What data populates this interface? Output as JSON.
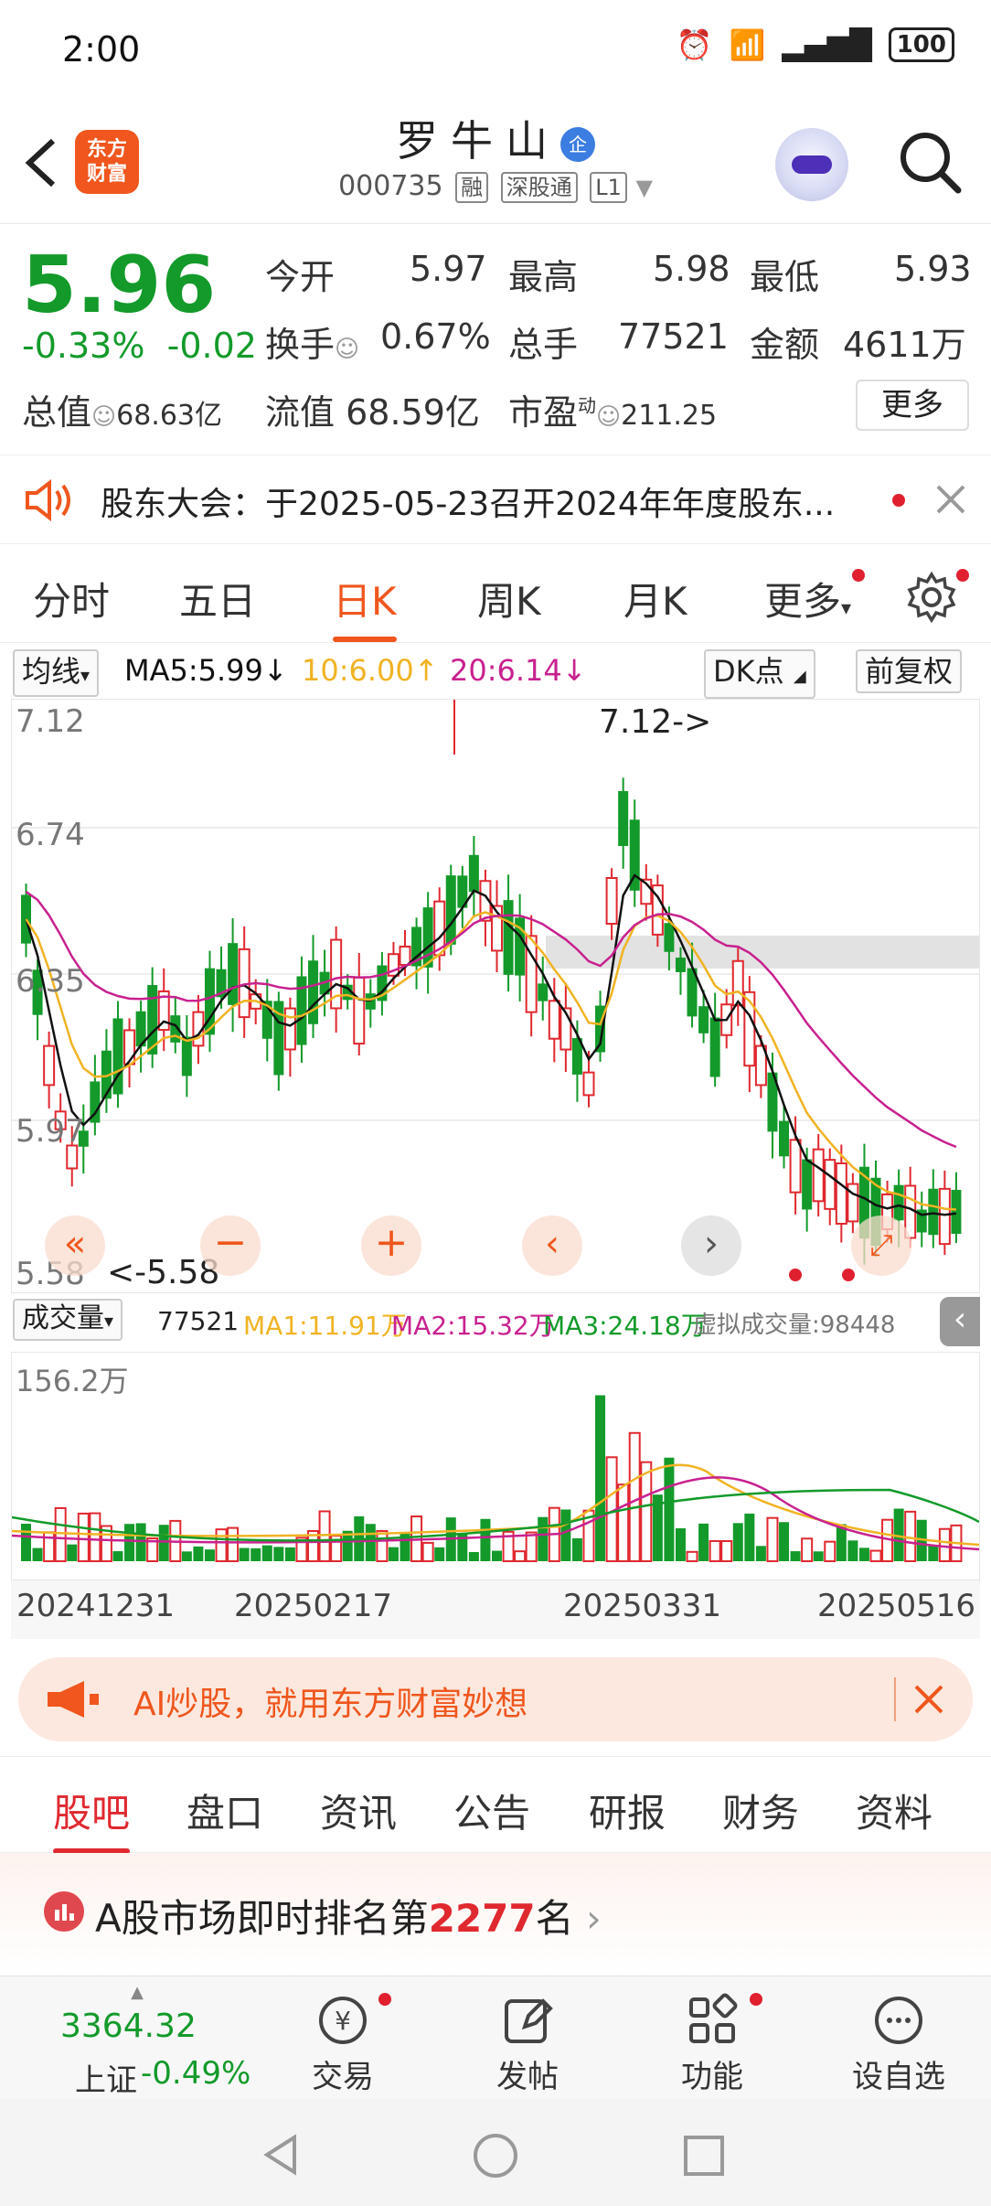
{
  "status_bar": {
    "time": "2:00",
    "battery": "100"
  },
  "header": {
    "logo_text_1": "东方",
    "logo_text_2": "财富",
    "title": "罗牛山",
    "enterprise_badge": "企",
    "code": "000735",
    "tags": [
      "融",
      "深股通",
      "L1"
    ]
  },
  "quote": {
    "price": "5.96",
    "change_pct": "-0.33%",
    "change": "-0.02",
    "open_label": "今开",
    "open": "5.97",
    "high_label": "最高",
    "high": "5.98",
    "low_label": "最低",
    "low": "5.93",
    "turnover_label": "换手",
    "turnover": "0.67%",
    "volume_label": "总手",
    "volume": "77521",
    "amount_label": "金额",
    "amount": "4611万",
    "mktcap_label": "总值",
    "mktcap": "68.63亿",
    "float_label": "流值",
    "float_cap": "68.59亿",
    "pe_label": "市盈",
    "pe_sup": "动",
    "pe": "211.25",
    "more": "更多"
  },
  "notice": {
    "text": "股东大会：于2025-05-23召开2024年年度股东..."
  },
  "chart_tabs": [
    "分时",
    "五日",
    "日K",
    "周K",
    "月K",
    "更多"
  ],
  "ma_bar": {
    "selector": "均线",
    "ma5": "MA5:5.99",
    "ma10": "10:6.00",
    "ma20": "20:6.14",
    "dk": "DK点",
    "fq": "前复权"
  },
  "colors": {
    "up": "#e0282f",
    "down": "#139a2a",
    "accent": "#f0561d",
    "ma5": "#111111",
    "ma10": "#f0b323",
    "ma20": "#c8218f"
  },
  "kchart_labels": {
    "p1": "7.12",
    "p2": "6.74",
    "p3": "6.35",
    "p4": "5.97",
    "p5": "5.58",
    "max_note": "7.12->",
    "min_note": "<-5.58"
  },
  "vol_bar": {
    "selector": "成交量",
    "vol": "77521",
    "ma1": "MA1:11.91万",
    "ma2": "MA2:15.32万",
    "ma3": "MA3:24.18万",
    "virtual": "虚拟成交量:98448",
    "max": "156.2万"
  },
  "dates": [
    "20241231",
    "20250217",
    "20250331",
    "20250516"
  ],
  "banner": {
    "text": "AI炒股，就用东方财富妙想"
  },
  "bottom_tabs": [
    "股吧",
    "盘口",
    "资讯",
    "公告",
    "研报",
    "财务",
    "资料"
  ],
  "rank": {
    "prefix": "A股市场即时排名第",
    "number": "2277",
    "suffix": "名"
  },
  "index": {
    "value": "3364.32",
    "name": "上证",
    "change": "-0.49%"
  },
  "bottom_nav": [
    "交易",
    "发帖",
    "功能",
    "设自选"
  ],
  "chart_data": {
    "type": "candlestick",
    "ylim": [
      5.58,
      7.12
    ],
    "high_mark": 7.12,
    "low_mark": 5.58,
    "ma_lines": [
      "MA5",
      "MA10",
      "MA20"
    ]
  }
}
